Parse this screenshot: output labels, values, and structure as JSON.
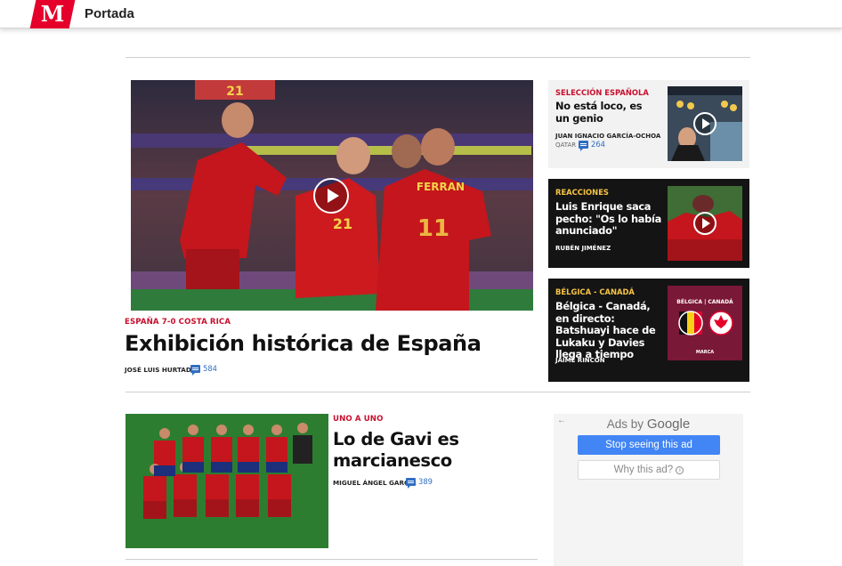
{
  "header": {
    "logo_letter": "M",
    "section": "Portada"
  },
  "hero": {
    "image_alt": "Jugadores de España celebrando un gol",
    "jersey_number": "21",
    "jersey_name": "FERRAN",
    "scoreboard": "21",
    "kicker": "ESPAÑA 7-0 COSTA RICA",
    "headline": "Exhibición histórica de España",
    "author": "JOSÉ LUIS HURTADO",
    "comments": "584"
  },
  "cards": [
    {
      "kicker": "SELECCIÓN ESPAÑOLA",
      "headline": "No está loco, es un genio",
      "author": "JUAN IGNACIO GARCÍA-OCHOA",
      "location": "QATAR",
      "comments": "264",
      "theme": "light"
    },
    {
      "kicker": "REACCIONES",
      "headline": "Luis Enrique saca pecho: \"Os lo había anunciado\"",
      "author": "RUBÉN JIMÉNEZ",
      "theme": "dark"
    },
    {
      "kicker": "BÉLGICA - CANADÁ",
      "headline": "Bélgica - Canadá, en directo: Batshuayi hace de Lukaku y Davies llega a tiempo",
      "author": "JAIME RINCÓN",
      "thumb_title": "BÉLGICA | CANADÁ",
      "thumb_footer": "MARCA",
      "theme": "dark"
    }
  ],
  "second": {
    "kicker": "UNO A UNO",
    "headline_line1": "Lo de Gavi es",
    "headline_line2": "marcianesco",
    "author": "MIGUEL ÁNGEL GARCÍA",
    "comments": "389"
  },
  "ad": {
    "back": "←",
    "ads_by": "Ads by",
    "brand": "Google",
    "stop_label": "Stop seeing this ad",
    "why_label": "Why this ad?",
    "info": "i"
  },
  "colors": {
    "brand_red": "#e4002b",
    "kicker_red": "#c8102e",
    "kicker_yellow": "#f6c445",
    "comment_blue": "#2f6ec2",
    "ad_blue": "#4285f4"
  }
}
